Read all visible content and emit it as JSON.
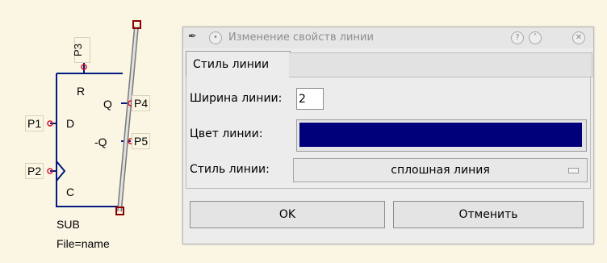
{
  "schematic": {
    "pins": {
      "p1": "P1",
      "p2": "P2",
      "p3": "P3",
      "p4": "P4",
      "p5": "P5"
    },
    "labels": {
      "r": "R",
      "d": "D",
      "q": "Q",
      "nq": "-Q",
      "c": "C"
    },
    "component_name": "SUB",
    "file_attr": "File=name",
    "colors": {
      "wire": "#001a80",
      "pin_dot": "#d0102c",
      "selection": "#8a0000"
    }
  },
  "dialog": {
    "title": "Изменение свойств линии",
    "icons": [
      "app-icon",
      "sticky-icon",
      "help-icon",
      "shade-icon",
      "close-icon"
    ],
    "tabs": [
      {
        "label": "Стиль линии"
      }
    ],
    "fields": {
      "width_label": "Ширина линии:",
      "width_value": "2",
      "color_label": "Цвет линии:",
      "color_value": "#00007a",
      "style_label": "Стиль линии:",
      "style_value": "сплошная линия"
    },
    "buttons": {
      "ok": "OK",
      "cancel": "Отменить"
    }
  }
}
